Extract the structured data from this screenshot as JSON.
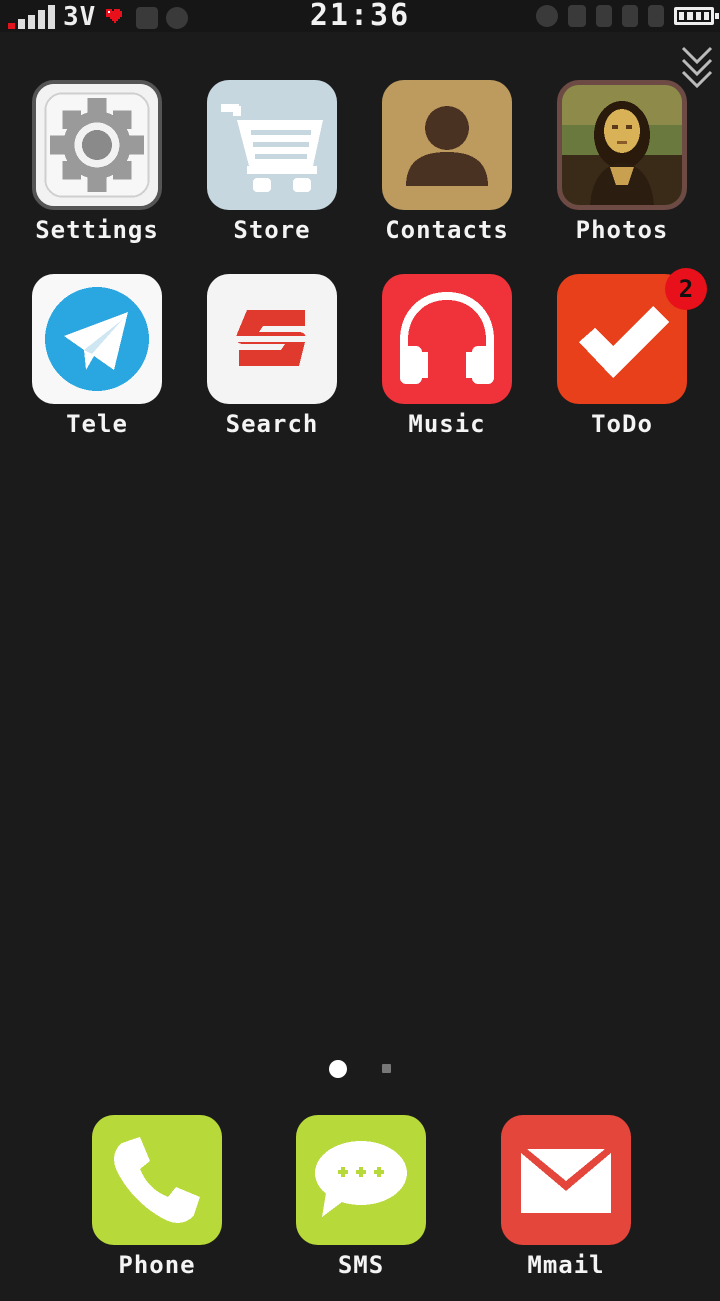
{
  "status_bar": {
    "network": "3V",
    "time": "21:36",
    "icons": [
      "signal-icon",
      "heart-icon",
      "plus-icon",
      "whatsapp-icon",
      "settings-icon",
      "bluetooth-icon",
      "t-icon",
      "pause-icon",
      "pause-icon",
      "battery-icon"
    ]
  },
  "home": {
    "apps": [
      {
        "label": "Settings",
        "icon": "gear-icon"
      },
      {
        "label": "Store",
        "icon": "shopping-cart-icon"
      },
      {
        "label": "Contacts",
        "icon": "person-icon"
      },
      {
        "label": "Photos",
        "icon": "mona-lisa-photo-icon"
      },
      {
        "label": "Tele",
        "icon": "paper-plane-icon"
      },
      {
        "label": "Search",
        "icon": "search-s-logo-icon"
      },
      {
        "label": "Music",
        "icon": "headphones-icon"
      },
      {
        "label": "ToDo",
        "icon": "checkmark-icon",
        "badge": "2"
      }
    ],
    "pages": {
      "count": 2,
      "active": 1
    }
  },
  "dock": {
    "apps": [
      {
        "label": "Phone",
        "icon": "phone-handset-icon"
      },
      {
        "label": "SMS",
        "icon": "speech-bubble-icon"
      },
      {
        "label": "Mmail",
        "icon": "envelope-icon"
      }
    ]
  },
  "colors": {
    "background": "#1b1b1b",
    "status_bar": "#161616",
    "tele_blue": "#2aa6e0",
    "search_red": "#e03a2e",
    "music_red": "#f0323a",
    "todo_orange": "#e8401a",
    "dock_green": "#b8d93a",
    "mmail_red": "#e4463c",
    "badge_red": "#e8101a"
  }
}
